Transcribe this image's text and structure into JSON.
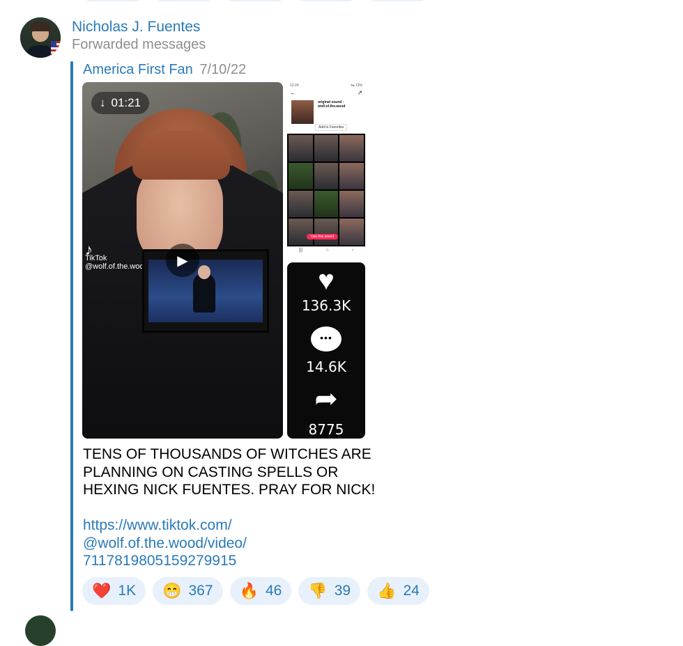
{
  "header": {
    "sender_name": "Nicholas J. Fuentes",
    "forwarded_label": "Forwarded messages"
  },
  "forward": {
    "original_author": "America First Fan",
    "original_date": "7/10/22"
  },
  "media": {
    "video_duration": "01:21",
    "download_icon": "arrow-down-icon",
    "play_icon": "play-icon",
    "watermark_brand": "TikTok",
    "watermark_handle": "@wolf.of.the.wood"
  },
  "screenshot_top": {
    "sound_title": "original sound -",
    "sound_author": "wolf.of.the.wood",
    "add_favorites": "Add to Favorites",
    "use_sound": "Use this sound"
  },
  "screenshot_stats": {
    "likes": "136.3K",
    "comments": "14.6K",
    "shares": "8775"
  },
  "message": {
    "line1": "TENS OF THOUSANDS OF WITCHES ARE",
    "line2": "PLANNING ON CASTING SPELLS OR",
    "line3": "HEXING NICK FUENTES. PRAY FOR NICK!",
    "link_line1": "https://www.tiktok.com/",
    "link_line2": "@wolf.of.the.wood/video/",
    "link_line3": "7117819805159279915"
  },
  "reactions": [
    {
      "emoji": "❤️",
      "count": "1K",
      "icon": "heart-icon"
    },
    {
      "emoji": "😁",
      "count": "367",
      "icon": "grin-icon"
    },
    {
      "emoji": "🔥",
      "count": "46",
      "icon": "fire-icon"
    },
    {
      "emoji": "👎",
      "count": "39",
      "icon": "thumbs-down-icon"
    },
    {
      "emoji": "👍",
      "count": "24",
      "icon": "thumbs-up-icon"
    }
  ],
  "colors": {
    "accent": "#2a7ab8",
    "secondary_text": "#8e8e93",
    "reaction_bg": "#e8f1fb"
  }
}
